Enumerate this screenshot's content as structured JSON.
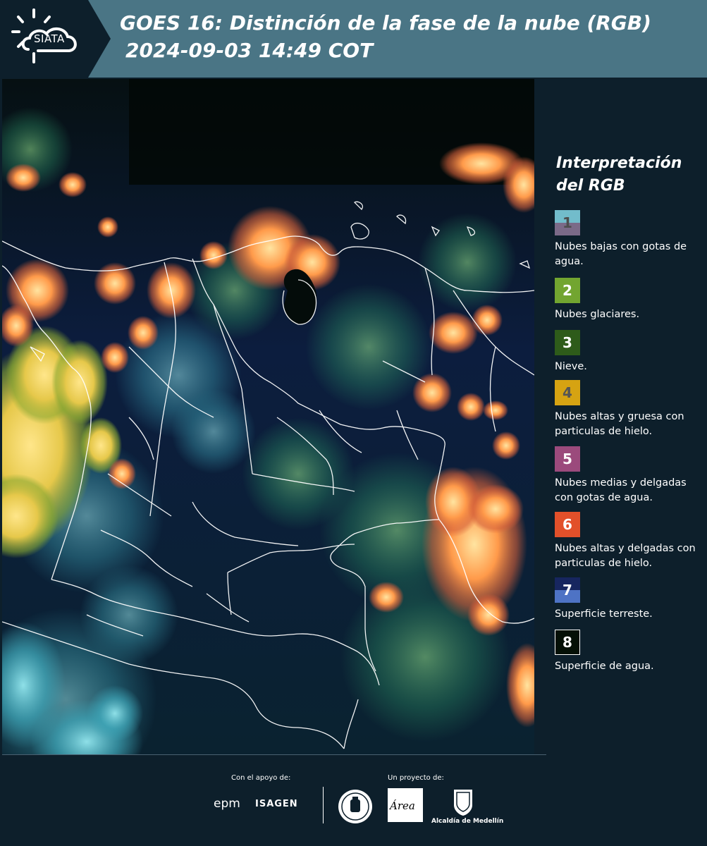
{
  "header": {
    "logo_text": "SIATA",
    "title_line1": "GOES 16: Distinción de la fase de la nube (RGB)",
    "title_line2": "2024-09-03 14:49 COT"
  },
  "legend": {
    "title_line1": "Interpretación",
    "title_line2": "del RGB",
    "items": [
      {
        "number": "1",
        "label": "Nubes bajas con gotas de agua.",
        "color_top": "#72bccb",
        "color_bottom": "#7b6a88"
      },
      {
        "number": "2",
        "label": "Nubes glaciares.",
        "color": "#72a530"
      },
      {
        "number": "3",
        "label": "Nieve.",
        "color": "#2e5b1a"
      },
      {
        "number": "4",
        "label": "Nubes altas y gruesa con particulas de hielo.",
        "color": "#d6a312",
        "text_color": "#555555"
      },
      {
        "number": "5",
        "label": "Nubes medias y delgadas con gotas de agua.",
        "color": "#9b4a7c"
      },
      {
        "number": "6",
        "label": "Nubes altas y delgadas con particulas de hielo.",
        "color": "#e2502a"
      },
      {
        "number": "7",
        "label": "Superficie terreste.",
        "color_top": "#17265f",
        "color_bottom": "#4e73c5"
      },
      {
        "number": "8",
        "label": "Superficie de agua.",
        "color": "#051006"
      }
    ]
  },
  "footer": {
    "support_label": "Con el apoyo de:",
    "project_label": "Un proyecto de:",
    "epm": "epm",
    "isagen": "ISAGEN",
    "area": "Área",
    "alcaldia": "Alcaldía de Medellín"
  },
  "colors": {
    "header_bg": "#4a7585",
    "panel_bg": "#0d1f2b",
    "boundary": "#ffffff"
  }
}
